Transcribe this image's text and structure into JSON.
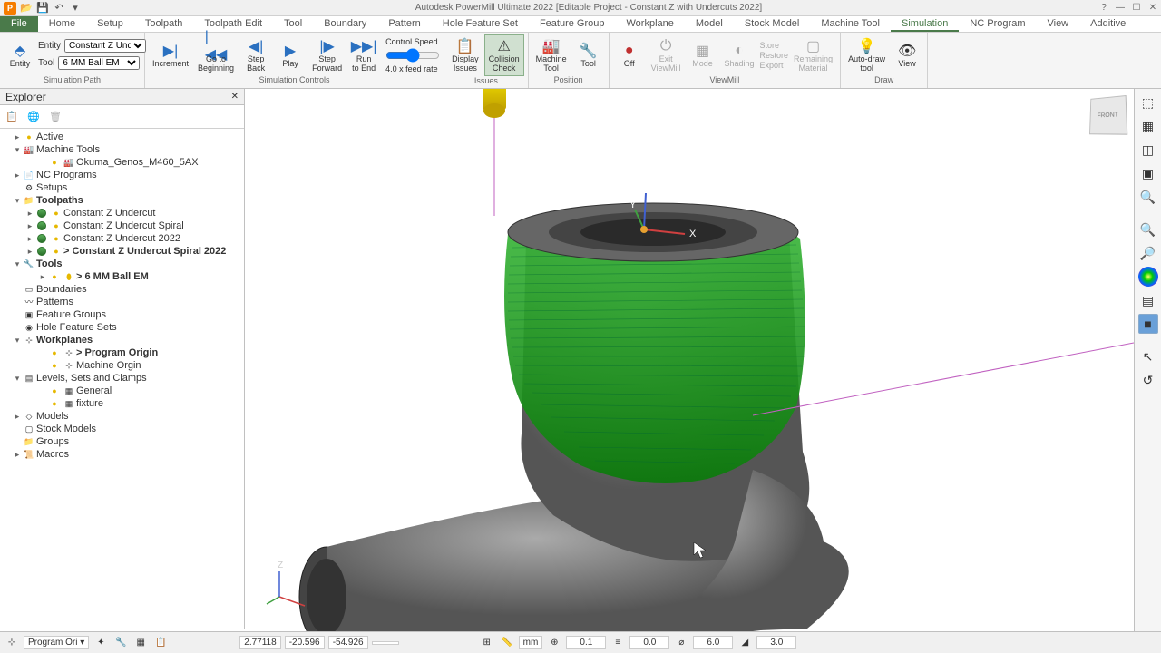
{
  "title": "Autodesk PowerMill Ultimate 2022    [Editable Project - Constant Z with Undercuts 2022]",
  "qat": {
    "save": "💾",
    "undo": "↶"
  },
  "window": {
    "help": "?",
    "min": "—",
    "max": "☐",
    "close": "✕"
  },
  "tabs": [
    "File",
    "Home",
    "Setup",
    "Toolpath",
    "Toolpath Edit",
    "Tool",
    "Boundary",
    "Pattern",
    "Hole Feature Set",
    "Feature Group",
    "Workplane",
    "Model",
    "Stock Model",
    "Machine Tool",
    "Simulation",
    "NC Program",
    "View",
    "Additive"
  ],
  "active_tab": 14,
  "ribbon": {
    "simpath": {
      "label": "Simulation Path",
      "entity_lbl": "Entity",
      "entity_val": "Constant Z Undercut Sp",
      "tool_lbl": "Tool",
      "tool_val": "6 MM Ball EM",
      "entity_btn": "Entity"
    },
    "controls": {
      "label": "Simulation Controls",
      "increment": "Increment",
      "go_begin": "Go to\nBeginning",
      "step_back": "Step\nBack",
      "play": "Play",
      "step_fwd": "Step\nForward",
      "run_end": "Run\nto End",
      "speed_lbl": "Control Speed",
      "feed_rate": "4.0 x feed rate"
    },
    "issues": {
      "label": "Issues",
      "display": "Display\nIssues",
      "collision": "Collision\nCheck"
    },
    "position": {
      "label": "Position",
      "machine": "Machine\nTool",
      "tool": "Tool"
    },
    "viewmill": {
      "label": "ViewMill",
      "off": "Off",
      "exit": "Exit\nViewMill",
      "mode": "Mode",
      "shading": "Shading",
      "store": "Store",
      "restore": "Restore",
      "export": "Export",
      "remaining": "Remaining\nMaterial"
    },
    "draw": {
      "label": "Draw",
      "auto": "Auto-draw\ntool",
      "view": "View"
    }
  },
  "explorer": {
    "title": "Explorer",
    "nodes": {
      "active": "Active",
      "machine_tools": "Machine Tools",
      "okuma": "Okuma_Genos_M460_5AX",
      "nc": "NC Programs",
      "setups": "Setups",
      "toolpaths": "Toolpaths",
      "tp1": "Constant Z Undercut",
      "tp2": "Constant Z Undercut Spiral",
      "tp3": "Constant Z Undercut  2022",
      "tp4": "> Constant Z Undercut Spiral 2022",
      "tools": "Tools",
      "tool1": "> 6 MM Ball EM",
      "boundaries": "Boundaries",
      "patterns": "Patterns",
      "fgroups": "Feature Groups",
      "hfs": "Hole Feature Sets",
      "workplanes": "Workplanes",
      "wp1": "> Program Origin",
      "wp2": "Machine Orgin",
      "lsc": "Levels, Sets and Clamps",
      "general": "General",
      "fixture": "fixture",
      "models": "Models",
      "stock": "Stock Models",
      "groups": "Groups",
      "macros": "Macros"
    }
  },
  "viewcube": "FRONT",
  "axes": {
    "x": "X",
    "y": "Y",
    "z": "Z",
    "z2": "Z"
  },
  "status": {
    "plane": "Program Ori",
    "x": "2.77118",
    "y": "-20.596",
    "z": "-54.926",
    "unit": "mm",
    "tol": "0.1",
    "thk": "0.0",
    "dia": "6.0",
    "tip": "3.0"
  }
}
